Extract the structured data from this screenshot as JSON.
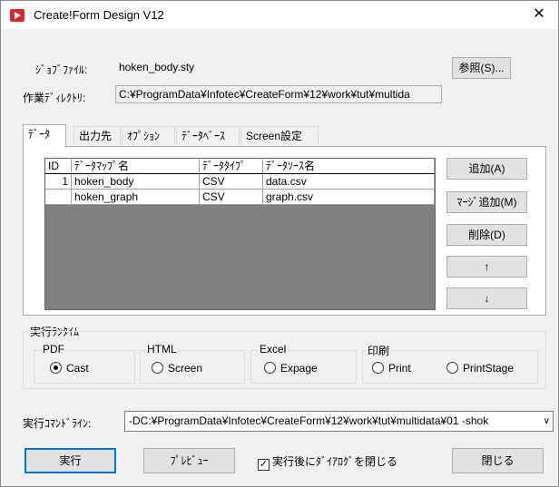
{
  "window": {
    "title": "Create!Form Design V12",
    "close_glyph": "✕"
  },
  "job_file": {
    "label": "ｼﾞｮﾌﾞﾌｧｲﾙ:",
    "value": "hoken_body.sty",
    "browse_label": "参照(S)..."
  },
  "work_dir": {
    "label": "作業ﾃﾞｨﾚｸﾄﾘ:",
    "value": "C:¥ProgramData¥Infotec¥CreateForm¥12¥work¥tut¥multida"
  },
  "tabs": [
    {
      "label": "ﾃﾞｰﾀ",
      "active": true
    },
    {
      "label": "出力先",
      "active": false
    },
    {
      "label": "ｵﾌﾟｼｮﾝ",
      "active": false
    },
    {
      "label": "ﾃﾞｰﾀﾍﾞｰｽ",
      "active": false
    },
    {
      "label": "Screen設定",
      "active": false
    }
  ],
  "data_table": {
    "columns": [
      "ID",
      "ﾃﾞｰﾀﾏｯﾌﾟ名",
      "ﾃﾞｰﾀﾀｲﾌﾟ",
      "ﾃﾞｰﾀｿｰｽ名"
    ],
    "rows": [
      [
        "1",
        "hoken_body",
        "CSV",
        "data.csv"
      ],
      [
        "",
        "hoken_graph",
        "CSV",
        "graph.csv"
      ]
    ]
  },
  "side_buttons": {
    "add": "追加(A)",
    "merge_add": "ﾏｰｼﾞ追加(M)",
    "delete": "削除(D)",
    "up": "↑",
    "down": "↓"
  },
  "runtime": {
    "label": "実行ﾗﾝﾀｲﾑ",
    "groups": [
      {
        "label": "PDF",
        "options": [
          {
            "label": "Cast",
            "selected": true
          }
        ]
      },
      {
        "label": "HTML",
        "options": [
          {
            "label": "Screen",
            "selected": false
          }
        ]
      },
      {
        "label": "Excel",
        "options": [
          {
            "label": "Expage",
            "selected": false
          }
        ]
      },
      {
        "label": "印刷",
        "options": [
          {
            "label": "Print",
            "selected": false
          },
          {
            "label": "PrintStage",
            "selected": false
          }
        ]
      }
    ]
  },
  "command_line": {
    "label": "実行ｺﾏﾝﾄﾞﾗｲﾝ:",
    "value": "-DC:¥ProgramData¥Infotec¥CreateForm¥12¥work¥tut¥multidata¥01 -shok"
  },
  "footer": {
    "run": "実行",
    "preview": "ﾌﾟﾚﾋﾞｭｰ",
    "close_after_run": "実行後にﾀﾞｲｱﾛｸﾞを閉じる",
    "close_after_run_checked": true,
    "close": "閉じる"
  }
}
